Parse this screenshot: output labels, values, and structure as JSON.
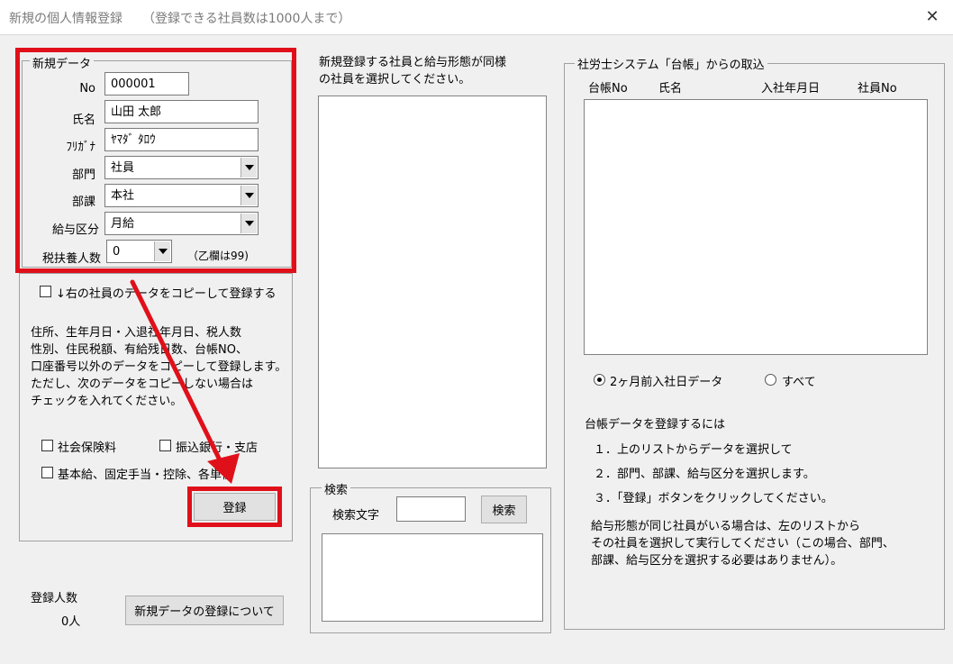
{
  "window": {
    "title": "新規の個人情報登録",
    "subtitle": "（登録できる社員数は1000人まで）"
  },
  "new_data": {
    "legend": "新規データ",
    "no_label": "No",
    "no_value": "000001",
    "name_label": "氏名",
    "name_value": "山田 太郎",
    "kana_label": "ﾌﾘｶﾞﾅ",
    "kana_value": "ﾔﾏﾀﾞ ﾀﾛｳ",
    "dept_label": "部門",
    "dept_value": "社員",
    "section_label": "部課",
    "section_value": "本社",
    "pay_label": "給与区分",
    "pay_value": "月給",
    "dependents_label": "税扶養人数",
    "dependents_value": "0",
    "dependents_note": "（乙欄は99)"
  },
  "copy": {
    "checkbox_label": "↓右の社員のデータをコピーして登録する",
    "description": [
      "住所、生年月日・入退社年月日、税人数",
      "性別、住民税額、有給残日数、台帳NO、",
      "口座番号以外のデータをコピーして登録します。",
      "ただし、次のデータをコピーしない場合は",
      "チェックを入れてください。"
    ],
    "opt_insurance": "社会保険料",
    "opt_bank": "振込銀行・支店",
    "opt_salary": "基本給、固定手当・控除、各単価",
    "register_button": "登録"
  },
  "footer": {
    "count_label": "登録人数",
    "count_value": "0人",
    "about_button": "新規データの登録について"
  },
  "middle": {
    "instruction_line1": "新規登録する社員と給与形態が同様",
    "instruction_line2": "の社員を選択してください。",
    "search_legend": "検索",
    "search_label": "検索文字",
    "search_value": "",
    "search_button": "検索"
  },
  "right": {
    "legend": "社労士システム「台帳」からの取込",
    "columns": [
      "台帳No",
      "氏名",
      "入社年月日",
      "社員No"
    ],
    "radio_recent": "2ヶ月前入社日データ",
    "radio_all": "すべて",
    "help_title": "台帳データを登録するには",
    "steps": [
      "１．上のリストからデータを選択して",
      "２．部門、部課、給与区分を選択します。",
      "３．「登録」ボタンをクリックしてください。"
    ],
    "note_lines": [
      "給与形態が同じ社員がいる場合は、左のリストから",
      "その社員を選択して実行してください（この場合、部門、",
      "部課、給与区分を選択する必要はありません）。"
    ]
  },
  "colors": {
    "highlight": "#e0101a",
    "window_bg": "#f0f0f0"
  }
}
